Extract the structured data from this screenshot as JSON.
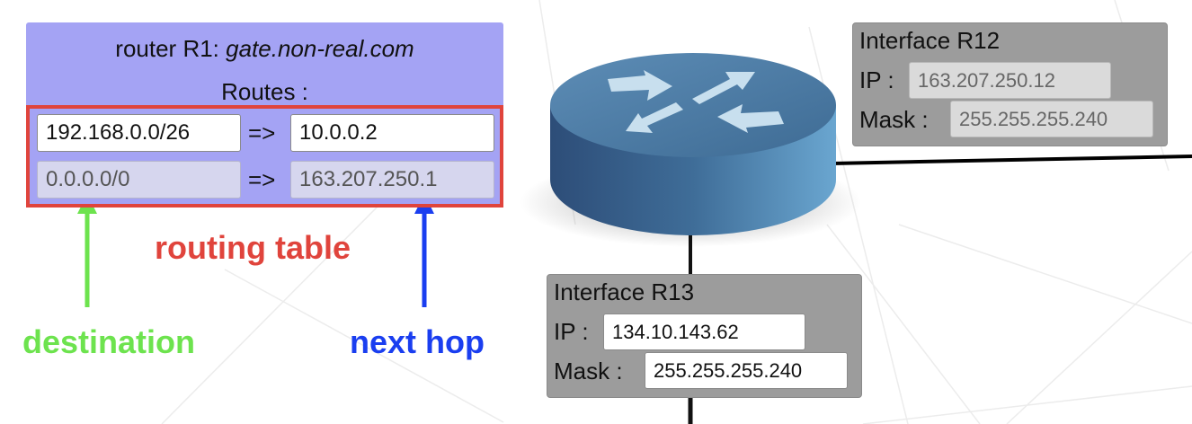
{
  "router": {
    "title_prefix": "router R1: ",
    "title_host": "gate.non-real.com",
    "routes_label": "Routes :",
    "routes": [
      {
        "destination": "192.168.0.0/26",
        "arrow": "=>",
        "next_hop": "10.0.0.2",
        "editable": true
      },
      {
        "destination": "0.0.0.0/0",
        "arrow": "=>",
        "next_hop": "163.207.250.1",
        "editable": false
      }
    ]
  },
  "interfaces": [
    {
      "title": "Interface R12",
      "ip_label": "IP :",
      "ip": "163.207.250.12",
      "mask_label": "Mask :",
      "mask": "255.255.255.240",
      "editable": false
    },
    {
      "title": "Interface R13",
      "ip_label": "IP :",
      "ip": "134.10.143.62",
      "mask_label": "Mask :",
      "mask": "255.255.255.240",
      "editable": true
    }
  ],
  "annotations": {
    "routing_table": "routing table",
    "destination": "destination",
    "next_hop": "next hop"
  },
  "colors": {
    "router_panel": "#a4a3f4",
    "routing_table_border": "#e0443c",
    "destination": "#6de34e",
    "next_hop": "#1a3ef0",
    "interface_panel": "#9c9c9c",
    "router_icon": "#4c7aa0"
  },
  "icons": [
    "router-icon",
    "destination-arrow-icon",
    "next-hop-arrow-icon"
  ]
}
